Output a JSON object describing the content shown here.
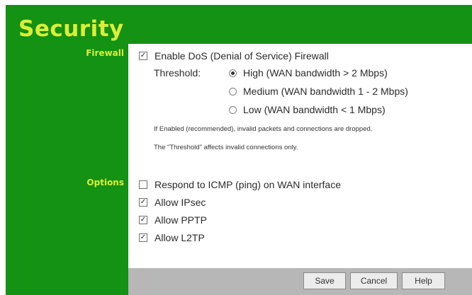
{
  "page": {
    "title": "Security"
  },
  "colors": {
    "green": "#139213",
    "title_yellow": "#dcee39",
    "button_bar": "#b7b7b7"
  },
  "firewall": {
    "label": "Firewall",
    "enable_dos": {
      "label": "Enable DoS (Denial of Service) Firewall",
      "checked": true
    },
    "threshold_label": "Threshold:",
    "options": [
      {
        "label": "High (WAN bandwidth > 2 Mbps)",
        "selected": true
      },
      {
        "label": "Medium (WAN bandwidth 1 - 2 Mbps)",
        "selected": false
      },
      {
        "label": "Low (WAN bandwidth < 1 Mbps)",
        "selected": false
      }
    ],
    "note_1": "If Enabled (recommended), invalid packets and connections are dropped.",
    "note_2": "The \"Threshold\" affects invalid connections only."
  },
  "options_section": {
    "label": "Options",
    "items": [
      {
        "label": "Respond to ICMP (ping) on WAN interface",
        "checked": false
      },
      {
        "label": "Allow IPsec",
        "checked": true
      },
      {
        "label": "Allow PPTP",
        "checked": true
      },
      {
        "label": "Allow L2TP",
        "checked": true
      }
    ]
  },
  "buttons": {
    "save": "Save",
    "cancel": "Cancel",
    "help": "Help"
  }
}
